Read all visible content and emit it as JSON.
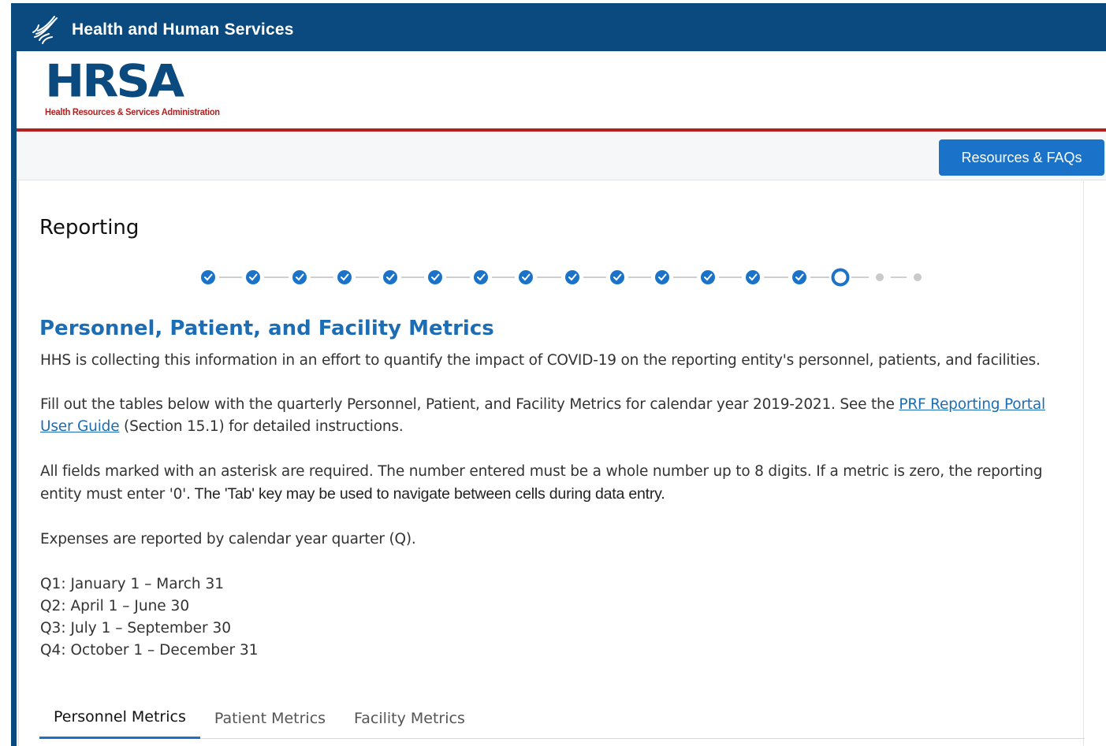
{
  "header": {
    "agency": "Health and Human Services",
    "logo_icon": "hhs-eagle-icon",
    "hrsa_word": "HRSA",
    "hrsa_subtitle": "Health Resources & Services Administration"
  },
  "toolbar": {
    "resources_label": "Resources & FAQs"
  },
  "page": {
    "title": "Reporting"
  },
  "progress": {
    "total_steps": 17,
    "completed_steps": 14,
    "current_step": 15,
    "colors": {
      "completed": "#1a73c9",
      "upcoming": "#c9c9c9",
      "connector": "#cfcfcf"
    }
  },
  "section": {
    "title": "Personnel, Patient, and Facility Metrics",
    "intro": "HHS is collecting this information in an effort to quantify the impact of COVID-19 on the reporting entity's personnel, patients, and facilities.",
    "instructions_before": "Fill out the tables below with the quarterly Personnel, Patient, and Facility Metrics for calendar year 2019-2021. See the ",
    "instructions_link": "PRF Reporting Portal User Guide",
    "instructions_after": " (Section 15.1) for detailed instructions.",
    "required_note_a": "All fields marked with an asterisk are required. The number entered must be a whole number up to 8 digits. If a metric is zero, the reporting entity must enter '0'.",
    "required_note_b": " The 'Tab' key may be used to navigate between cells during data entry.",
    "expenses_note": "Expenses are reported by calendar year quarter (Q).",
    "quarters": [
      "Q1: January 1 – March 31",
      "Q2: April 1 – June 30",
      "Q3: July 1 – September 30",
      "Q4: October 1 – December 31"
    ]
  },
  "tabs": [
    {
      "label": "Personnel Metrics",
      "active": true
    },
    {
      "label": "Patient Metrics",
      "active": false
    },
    {
      "label": "Facility Metrics",
      "active": false
    }
  ]
}
